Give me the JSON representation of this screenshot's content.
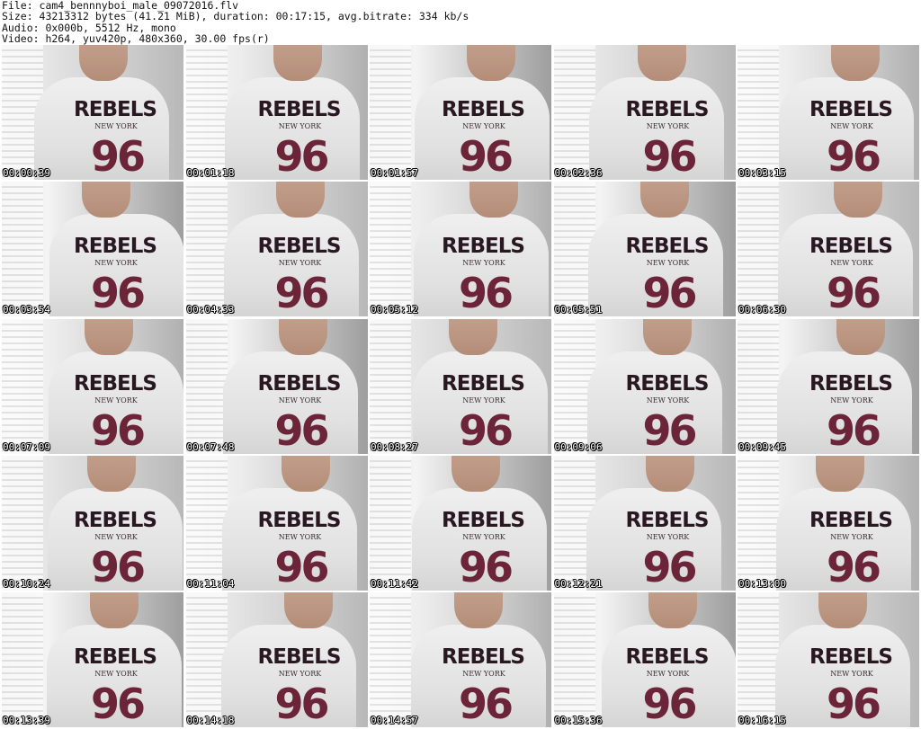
{
  "header": {
    "file_line": "File: cam4_bennnyboi_male_09072016.flv",
    "size_line": "Size: 43213312 bytes (41.21 MiB), duration: 00:17:15, avg.bitrate: 334 kb/s",
    "audio_line": "Audio: 0x000b, 5512 Hz, mono",
    "video_line": "Video: h264, yuv420p, 480x360, 30.00 fps(r)"
  },
  "thumbnail_text": {
    "shirt_logo": "REBELS",
    "shirt_sub": "NEW YORK",
    "shirt_number": "96"
  },
  "thumbnails": [
    {
      "timestamp": "00:00:39"
    },
    {
      "timestamp": "00:01:18"
    },
    {
      "timestamp": "00:01:57"
    },
    {
      "timestamp": "00:02:36"
    },
    {
      "timestamp": "00:03:15"
    },
    {
      "timestamp": "00:03:54"
    },
    {
      "timestamp": "00:04:33"
    },
    {
      "timestamp": "00:05:12"
    },
    {
      "timestamp": "00:05:51"
    },
    {
      "timestamp": "00:06:30"
    },
    {
      "timestamp": "00:07:09"
    },
    {
      "timestamp": "00:07:48"
    },
    {
      "timestamp": "00:08:27"
    },
    {
      "timestamp": "00:09:06"
    },
    {
      "timestamp": "00:09:45"
    },
    {
      "timestamp": "00:10:24"
    },
    {
      "timestamp": "00:11:04"
    },
    {
      "timestamp": "00:11:42"
    },
    {
      "timestamp": "00:12:21"
    },
    {
      "timestamp": "00:13:00"
    },
    {
      "timestamp": "00:13:39"
    },
    {
      "timestamp": "00:14:18"
    },
    {
      "timestamp": "00:14:57"
    },
    {
      "timestamp": "00:15:36"
    },
    {
      "timestamp": "00:16:15"
    }
  ]
}
